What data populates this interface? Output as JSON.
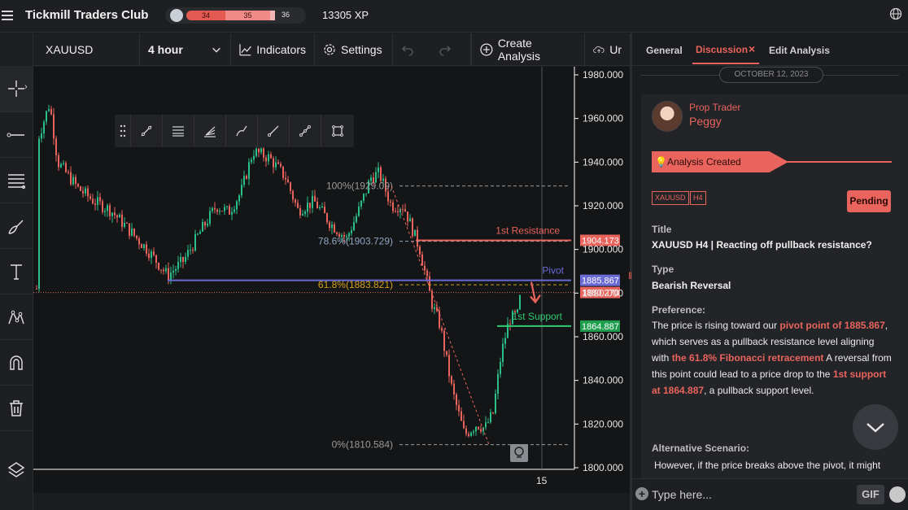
{
  "app": {
    "title": "Tickmill Traders Club",
    "xp": "13305 XP"
  },
  "levels": {
    "current": "34",
    "mid": "35",
    "next": "36"
  },
  "chart_header": {
    "symbol": "XAUUSD",
    "interval": "4 hour",
    "indicators": "Indicators",
    "settings": "Settings",
    "create_analysis": "Create Analysis",
    "cut_label": "Ur"
  },
  "chart": {
    "y_ticks": [
      "1980.000",
      "1960.000",
      "1940.000",
      "1920.000",
      "1900.000",
      "1880.000",
      "1860.000",
      "1840.000",
      "1820.000",
      "1800.000"
    ],
    "x_tick": "15",
    "fib_100": "100%(1929.09)",
    "fib_786": "78.6%(1903.729)",
    "fib_618": "61.8%(1883.821)",
    "fib_0": "0%(1810.584)",
    "resistance_label": "1st Resistance",
    "pivot_label": "Pivot",
    "support_label": "1st Support",
    "price_resistance": "1904.173",
    "price_pivot": "1885.867",
    "price_last": "1880.270",
    "price_support": "1864.887",
    "colors": {
      "resistance": "#e8645c",
      "pivot": "#6b6bd6",
      "support": "#2ecc71",
      "fib": "#d4a017",
      "bull": "#2bbf8a",
      "bear": "#e8645c"
    }
  },
  "panel": {
    "tabs": {
      "general": "General",
      "discussion": "Discussion",
      "close": "×",
      "edit": "Edit Analysis"
    },
    "date": "OCTOBER 12, 2023",
    "role": "Prop Trader",
    "user": "Peggy",
    "banner": "Analysis Created",
    "tag_symbol": "XAUUSD",
    "tag_tf": "H4",
    "status": "Pending",
    "title_label": "Title",
    "title_value": "XAUUSD H4 | Reacting off pullback resistance?",
    "type_label": "Type",
    "type_value": "Bearish Reversal",
    "pref_label": "Preference:",
    "pref_1": "The price is rising toward our ",
    "pref_hl1": "pivot point of 1885.867",
    "pref_2": ", which serves as a pullback resistance level aligning with ",
    "pref_hl2": "the 61.8% Fibonacci retracement",
    "pref_3": " A reversal from this point could lead to a price drop to the ",
    "pref_hl3": "1st support at 1864.887",
    "pref_4": ", a pullback support level.",
    "alt_label": "Alternative Scenario:",
    "alt_text": "However, if the price breaks above the pivot, it might",
    "composer_placeholder": "Type here...",
    "gif": "GIF"
  }
}
